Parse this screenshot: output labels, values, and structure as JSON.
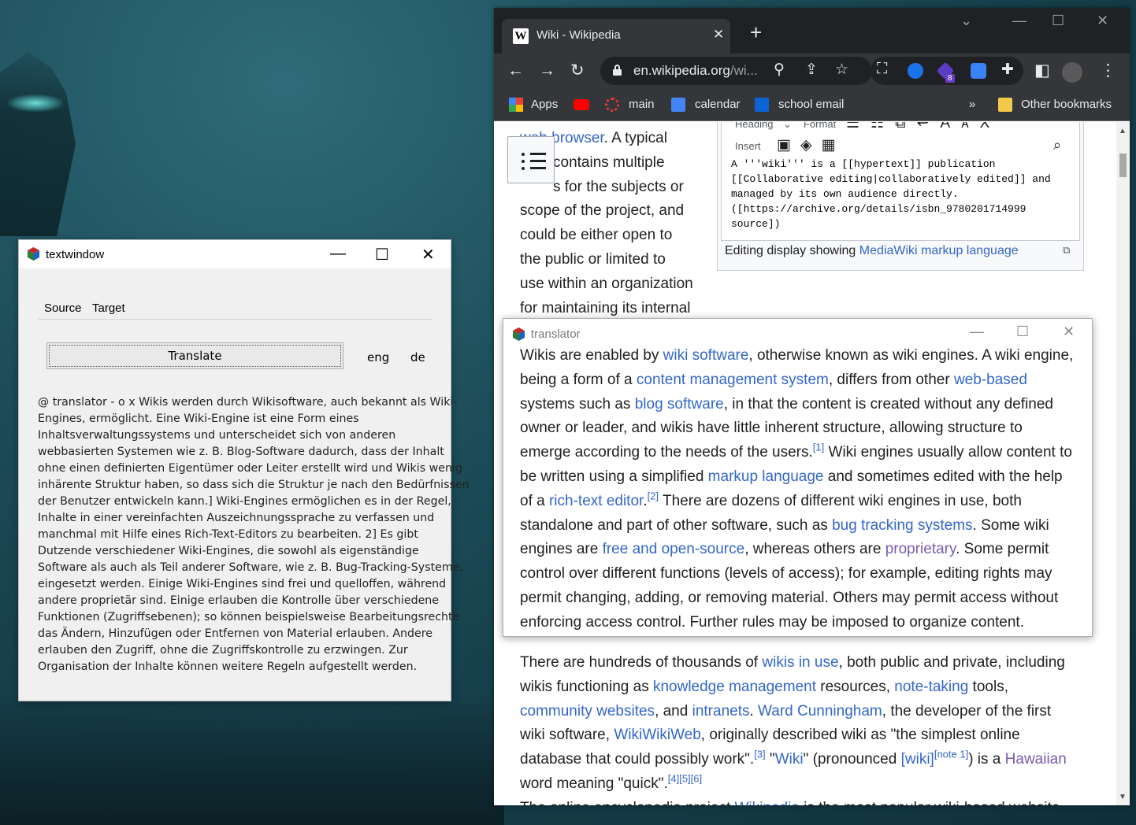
{
  "browser": {
    "tab_title": "Wiki - Wikipedia",
    "url_main": "en.wikipedia.org",
    "url_rest": "/wi...",
    "extension_badge": "8",
    "bookmarks": [
      "Apps",
      "main",
      "calendar",
      "school email"
    ],
    "bookmarks_overflow": "»",
    "other_bookmarks": "Other bookmarks"
  },
  "wiki": {
    "left_lines": [
      [
        {
          "t": "web browser",
          "c": "link"
        },
        {
          "t": ". A typical"
        }
      ],
      [
        {
          "t": "contains multiple"
        }
      ],
      [
        {
          "t": "s for the subjects or"
        }
      ],
      [
        {
          "t": "scope of the project, and"
        }
      ],
      [
        {
          "t": "could be either open to"
        }
      ],
      [
        {
          "t": "the public or limited to"
        }
      ],
      [
        {
          "t": "use within an organization"
        }
      ],
      [
        {
          "t": "for maintaining its internal"
        }
      ]
    ],
    "editor_toolbar": {
      "heading": "Heading",
      "format": "Format",
      "insert": "Insert"
    },
    "editor_code": "A '''wiki''' is a [[hypertext]] publication\n[[Collaborative editing|collaboratively edited]] and\nmanaged by its own audience directly.\n([https://archive.org/details/isbn_9780201714999\nsource])",
    "caption_text": "Editing display showing ",
    "caption_link": "MediaWiki markup language",
    "lower_lines": [
      [
        {
          "t": "There are hundreds of thousands of "
        },
        {
          "t": "wikis in use",
          "c": "link"
        },
        {
          "t": ", both public and private, including"
        }
      ],
      [
        {
          "t": "wikis functioning as "
        },
        {
          "t": "knowledge management",
          "c": "link"
        },
        {
          "t": " resources, "
        },
        {
          "t": "note-taking",
          "c": "link"
        },
        {
          "t": " tools,"
        }
      ],
      [
        {
          "t": "community websites",
          "c": "link"
        },
        {
          "t": ", and "
        },
        {
          "t": "intranets",
          "c": "link"
        },
        {
          "t": ". "
        },
        {
          "t": "Ward Cunningham",
          "c": "link"
        },
        {
          "t": ", the developer of the first"
        }
      ],
      [
        {
          "t": "wiki software, "
        },
        {
          "t": "WikiWikiWeb",
          "c": "link"
        },
        {
          "t": ", originally described wiki as \"the simplest online"
        }
      ],
      [
        {
          "t": "database that could possibly work\"."
        },
        {
          "t": "[3]",
          "c": "link",
          "s": 1
        },
        {
          "t": " \""
        },
        {
          "t": "Wiki",
          "c": "link"
        },
        {
          "t": "\" (pronounced "
        },
        {
          "t": "[wiki]",
          "c": "link"
        },
        {
          "t": "[note 1]",
          "c": "link",
          "s": 1
        },
        {
          "t": ") is a "
        },
        {
          "t": "Hawaiian",
          "c": "visited"
        }
      ],
      [
        {
          "t": "word meaning \"quick\"."
        },
        {
          "t": "[4][5][6]",
          "c": "link",
          "s": 1
        }
      ],
      [
        {
          "t": "The online encyclopedia project "
        },
        {
          "t": "Wikipedia",
          "c": "link"
        },
        {
          "t": " is the most popular wiki-based website"
        }
      ]
    ]
  },
  "translator": {
    "title": "translator",
    "lines": [
      [
        {
          "t": "Wikis are enabled by "
        },
        {
          "t": "wiki software",
          "c": "link"
        },
        {
          "t": ", otherwise known as wiki engines. A wiki engine,"
        }
      ],
      [
        {
          "t": "being a form of a "
        },
        {
          "t": "content management system",
          "c": "link"
        },
        {
          "t": ", differs from other "
        },
        {
          "t": "web-based",
          "c": "link"
        }
      ],
      [
        {
          "t": "systems such as "
        },
        {
          "t": "blog software",
          "c": "link"
        },
        {
          "t": ", in that the content is created without any defined"
        }
      ],
      [
        {
          "t": "owner or leader, and wikis have little inherent structure, allowing structure to"
        }
      ],
      [
        {
          "t": "emerge according to the needs of the users."
        },
        {
          "t": "[1]",
          "c": "link",
          "s": 1
        },
        {
          "t": " Wiki engines usually allow content to"
        }
      ],
      [
        {
          "t": "be written using a simplified "
        },
        {
          "t": "markup language",
          "c": "link"
        },
        {
          "t": " and sometimes edited with the help"
        }
      ],
      [
        {
          "t": "of a "
        },
        {
          "t": "rich-text editor",
          "c": "link"
        },
        {
          "t": "."
        },
        {
          "t": "[2]",
          "c": "link",
          "s": 1
        },
        {
          "t": " There are dozens of different wiki engines in use, both"
        }
      ],
      [
        {
          "t": "standalone and part of other software, such as "
        },
        {
          "t": "bug tracking systems",
          "c": "link"
        },
        {
          "t": ". Some wiki"
        }
      ],
      [
        {
          "t": "engines are "
        },
        {
          "t": "free and open-source",
          "c": "link"
        },
        {
          "t": ", whereas others are "
        },
        {
          "t": "proprietary",
          "c": "visited"
        },
        {
          "t": ". Some permit"
        }
      ],
      [
        {
          "t": "control over different functions (levels of access); for example, editing rights may"
        }
      ],
      [
        {
          "t": "permit changing, adding, or removing material. Others may permit access without"
        }
      ],
      [
        {
          "t": "enforcing access control. Further rules may be imposed to organize content."
        }
      ]
    ]
  },
  "textwindow": {
    "title": "textwindow",
    "tabs": [
      "Source",
      "Target"
    ],
    "translate_label": "Translate",
    "lang_from": "eng",
    "lang_to": "de",
    "body_lines": [
      "@ translator - o x Wikis werden durch Wikisoftware, auch bekannt als Wiki-",
      "Engines, ermöglicht. Eine Wiki-Engine ist eine Form eines",
      "Inhaltsverwaltungssystems und unterscheidet sich von anderen",
      "webbasierten Systemen wie z. B. Blog-Software dadurch, dass der Inhalt",
      "ohne einen definierten Eigentümer oder Leiter erstellt wird und Wikis wenig",
      "inhärente Struktur haben, so dass sich die Struktur je nach den Bedürfnissen",
      "der Benutzer entwickeln kann.] Wiki-Engines ermöglichen es in der Regel,",
      "Inhalte in einer vereinfachten Auszeichnungssprache zu verfassen und",
      "manchmal mit Hilfe eines Rich-Text-Editors zu bearbeiten. 2] Es gibt",
      "Dutzende verschiedener Wiki-Engines, die sowohl als eigenständige",
      "Software als auch als Teil anderer Software, wie z. B. Bug-Tracking-Systeme,",
      "eingesetzt werden. Einige Wiki-Engines sind frei und quelloffen, während",
      "andere proprietär sind. Einige erlauben die Kontrolle über verschiedene",
      "Funktionen (Zugriffsebenen); so können beispielsweise Bearbeitungsrechte",
      "das Ändern, Hinzufügen oder Entfernen von Material erlauben. Andere",
      "erlauben den Zugriff, ohne die Zugriffskontrolle zu erzwingen. Zur",
      "Organisation der Inhalte können weitere Regeln aufgestellt werden."
    ]
  },
  "colors": {
    "link": "#3366cc",
    "visited": "#795cb2",
    "chrome_dark": "#202124",
    "chrome_toolbar": "#35363a"
  }
}
